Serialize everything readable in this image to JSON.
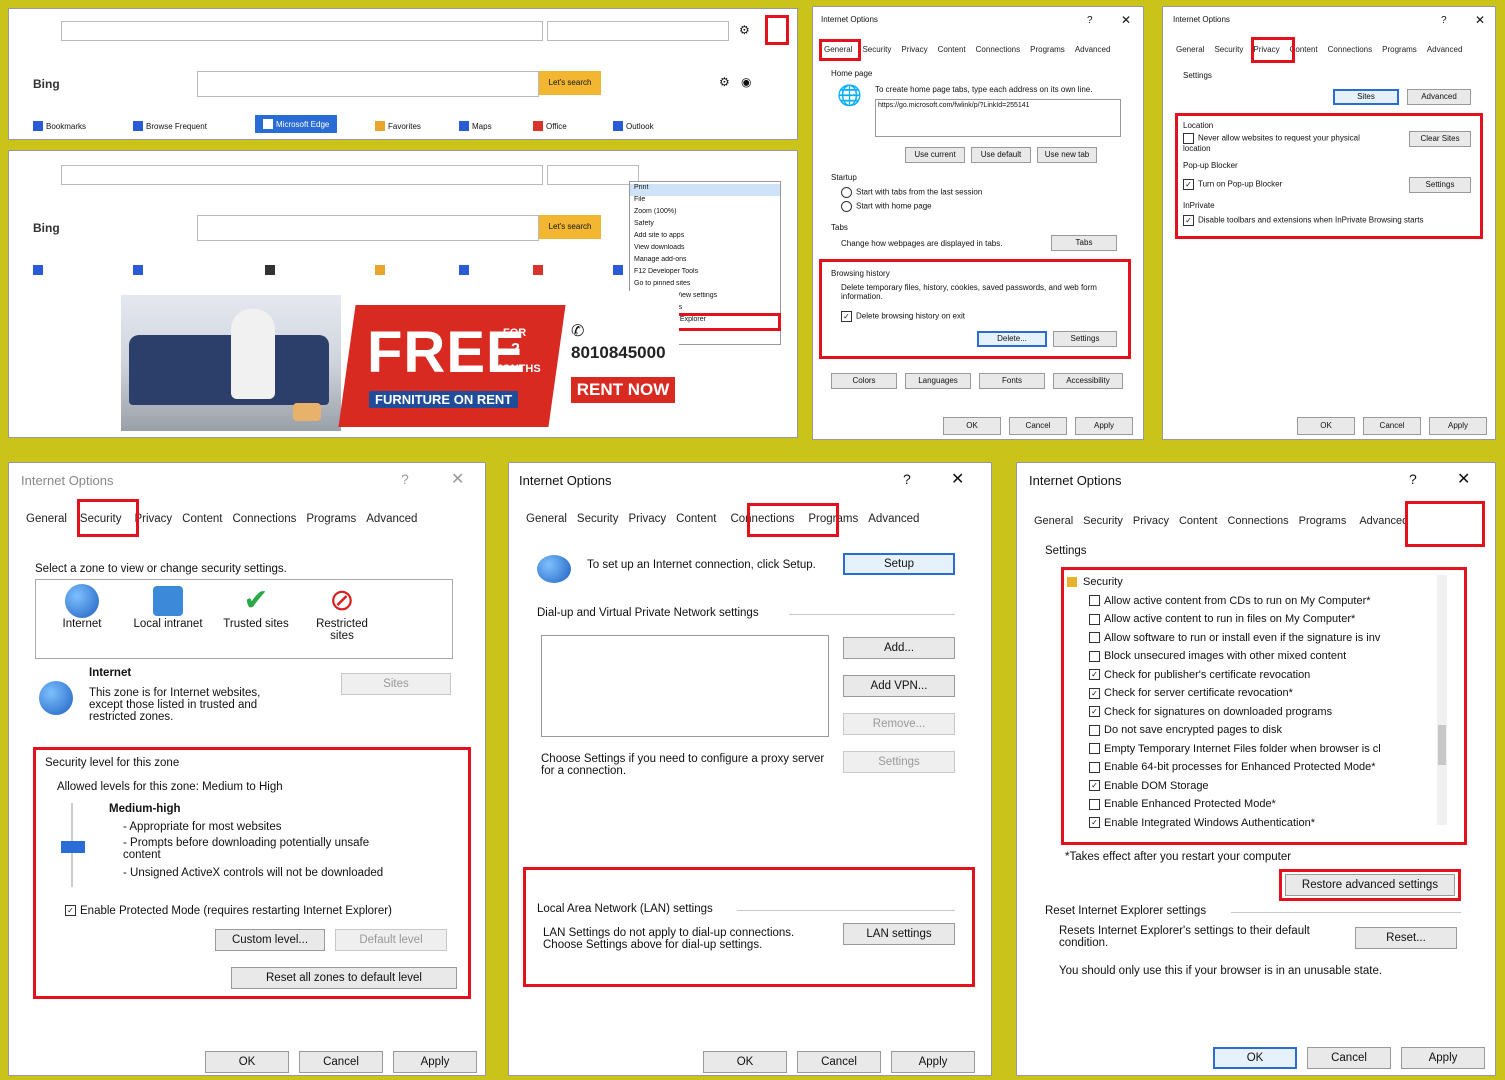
{
  "browser1": {
    "search_button": "Let's search",
    "logo": "Bing",
    "url_placeholder": "",
    "bookmarks": [
      "Bookmarks",
      "Browse Frequent",
      "Microsoft Edge",
      "Favorites",
      "Maps",
      "Office",
      "Outlook"
    ]
  },
  "browser2": {
    "search_button": "Let's search",
    "logo": "Bing",
    "menu_items": [
      "Print",
      "File",
      "Zoom (100%)",
      "Safety",
      "Add site to apps",
      "View downloads",
      "Manage add-ons",
      "F12 Developer Tools",
      "Go to pinned sites",
      "Compatibility View settings",
      "Internet options",
      "About Internet Explorer"
    ],
    "ad": {
      "headline": "FREE",
      "for": "FOR",
      "months_num": "2",
      "months": "MONTHS",
      "subtitle": "FURNITURE ON RENT",
      "phone": "8010845000",
      "cta": "RENT NOW"
    }
  },
  "general_dialog": {
    "title": "Internet Options",
    "tabs": [
      "General",
      "Security",
      "Privacy",
      "Content",
      "Connections",
      "Programs",
      "Advanced"
    ],
    "home_page_label": "Home page",
    "home_page_text": "To create home page tabs, type each address on its own line.",
    "home_url": "https://go.microsoft.com/fwlink/p/?LinkId=255141",
    "btn_use_current": "Use current",
    "btn_use_default": "Use default",
    "btn_use_new_tab": "Use new tab",
    "startup_label": "Startup",
    "startup_opt1": "Start with tabs from the last session",
    "startup_opt2": "Start with home page",
    "tabs_label": "Tabs",
    "tabs_text": "Change how webpages are displayed in tabs.",
    "btn_tabs": "Tabs",
    "history_label": "Browsing history",
    "history_text": "Delete temporary files, history, cookies, saved passwords, and web form information.",
    "history_check": "Delete browsing history on exit",
    "btn_delete": "Delete...",
    "btn_settings": "Settings",
    "appearance": [
      "Colors",
      "Languages",
      "Fonts",
      "Accessibility"
    ],
    "ok": "OK",
    "cancel": "Cancel",
    "apply": "Apply"
  },
  "privacy_dialog": {
    "title": "Internet Options",
    "tabs": [
      "General",
      "Security",
      "Privacy",
      "Content",
      "Connections",
      "Programs",
      "Advanced"
    ],
    "settings_label": "Settings",
    "btn_sites": "Sites",
    "btn_advanced": "Advanced",
    "location_label": "Location",
    "location_text": "Never allow websites to request your physical location",
    "btn_clear_sites": "Clear Sites",
    "popup_label": "Pop-up Blocker",
    "popup_text": "Turn on Pop-up Blocker",
    "btn_popup_settings": "Settings",
    "inprivate_label": "InPrivate",
    "inprivate_text": "Disable toolbars and extensions when InPrivate Browsing starts",
    "ok": "OK",
    "cancel": "Cancel",
    "apply": "Apply"
  },
  "security_dialog": {
    "title": "Internet Options",
    "tabs": [
      "General",
      "Security",
      "Privacy",
      "Content",
      "Connections",
      "Programs",
      "Advanced"
    ],
    "zone_prompt": "Select a zone to view or change security settings.",
    "zones": [
      "Internet",
      "Local intranet",
      "Trusted sites",
      "Restricted sites"
    ],
    "zone_title": "Internet",
    "zone_desc": "This zone is for Internet websites, except those listed in trusted and restricted zones.",
    "btn_sites": "Sites",
    "level_label": "Security level for this zone",
    "allowed_levels": "Allowed levels for this zone: Medium to High",
    "level_name": "Medium-high",
    "level_bullets": [
      "- Appropriate for most websites",
      "- Prompts before downloading potentially unsafe content",
      "- Unsigned ActiveX controls will not be downloaded"
    ],
    "protected_mode": "Enable Protected Mode (requires restarting Internet Explorer)",
    "btn_custom": "Custom level...",
    "btn_default": "Default level",
    "btn_reset_all": "Reset all zones to default level",
    "ok": "OK",
    "cancel": "Cancel",
    "apply": "Apply"
  },
  "connections_dialog": {
    "title": "Internet Options",
    "tabs": [
      "General",
      "Security",
      "Privacy",
      "Content",
      "Connections",
      "Programs",
      "Advanced"
    ],
    "setup_text": "To set up an Internet connection, click Setup.",
    "btn_setup": "Setup",
    "dialup_label": "Dial-up and Virtual Private Network settings",
    "btn_add": "Add...",
    "btn_add_vpn": "Add VPN...",
    "btn_remove": "Remove...",
    "btn_settings": "Settings",
    "proxy_text": "Choose Settings if you need to configure a proxy server for a connection.",
    "lan_label": "Local Area Network (LAN) settings",
    "lan_text": "LAN Settings do not apply to dial-up connections. Choose Settings above for dial-up settings.",
    "btn_lan": "LAN settings",
    "ok": "OK",
    "cancel": "Cancel",
    "apply": "Apply"
  },
  "advanced_dialog": {
    "title": "Internet Options",
    "tabs": [
      "General",
      "Security",
      "Privacy",
      "Content",
      "Connections",
      "Programs",
      "Advanced"
    ],
    "settings_label": "Settings",
    "group": "Security",
    "items": [
      {
        "label": "Allow active content from CDs to run on My Computer*",
        "checked": false
      },
      {
        "label": "Allow active content to run in files on My Computer*",
        "checked": false
      },
      {
        "label": "Allow software to run or install even if the signature is inv",
        "checked": false
      },
      {
        "label": "Block unsecured images with other mixed content",
        "checked": false
      },
      {
        "label": "Check for publisher's certificate revocation",
        "checked": true
      },
      {
        "label": "Check for server certificate revocation*",
        "checked": true
      },
      {
        "label": "Check for signatures on downloaded programs",
        "checked": true
      },
      {
        "label": "Do not save encrypted pages to disk",
        "checked": false
      },
      {
        "label": "Empty Temporary Internet Files folder when browser is cl",
        "checked": false
      },
      {
        "label": "Enable 64-bit processes for Enhanced Protected Mode*",
        "checked": false
      },
      {
        "label": "Enable DOM Storage",
        "checked": true
      },
      {
        "label": "Enable Enhanced Protected Mode*",
        "checked": false
      },
      {
        "label": "Enable Integrated Windows Authentication*",
        "checked": true
      }
    ],
    "note": "*Takes effect after you restart your computer",
    "btn_restore": "Restore advanced settings",
    "reset_label": "Reset Internet Explorer settings",
    "reset_text": "Resets Internet Explorer's settings to their default condition.",
    "btn_reset": "Reset...",
    "reset_warning": "You should only use this if your browser is in an unusable state.",
    "ok": "OK",
    "cancel": "Cancel",
    "apply": "Apply"
  }
}
